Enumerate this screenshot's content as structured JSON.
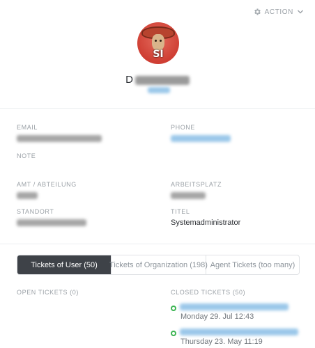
{
  "header": {
    "action_label": "ACTION",
    "action_icon": "gear-icon",
    "chevron_icon": "chevron-down-icon"
  },
  "profile": {
    "avatar_initials": "SI",
    "name_first_letter": "D"
  },
  "fields": {
    "email_label": "EMAIL",
    "phone_label": "PHONE",
    "note_label": "NOTE",
    "department_label": "AMT / ABTEILUNG",
    "workplace_label": "ARBEITSPLATZ",
    "location_label": "STANDORT",
    "title_label": "TITEL",
    "title_value": "Systemadministrator"
  },
  "tabs": [
    {
      "label": "Tickets of User (50)",
      "active": true
    },
    {
      "label": "Tickets of Organization (198)",
      "active": false
    },
    {
      "label": "Agent Tickets (too many)",
      "active": false
    }
  ],
  "open_tickets": {
    "label": "OPEN TICKETS (0)"
  },
  "closed_tickets": {
    "label": "CLOSED TICKETS (50)",
    "items": [
      {
        "date": "Monday 29. Jul 12:43"
      },
      {
        "date": "Thursday 23. May 11:19"
      }
    ]
  },
  "colors": {
    "active_tab": "#3e4248",
    "status_closed": "#3bb452",
    "link_blue": "#9bc8ea",
    "avatar_bg": "#cf3e33"
  }
}
